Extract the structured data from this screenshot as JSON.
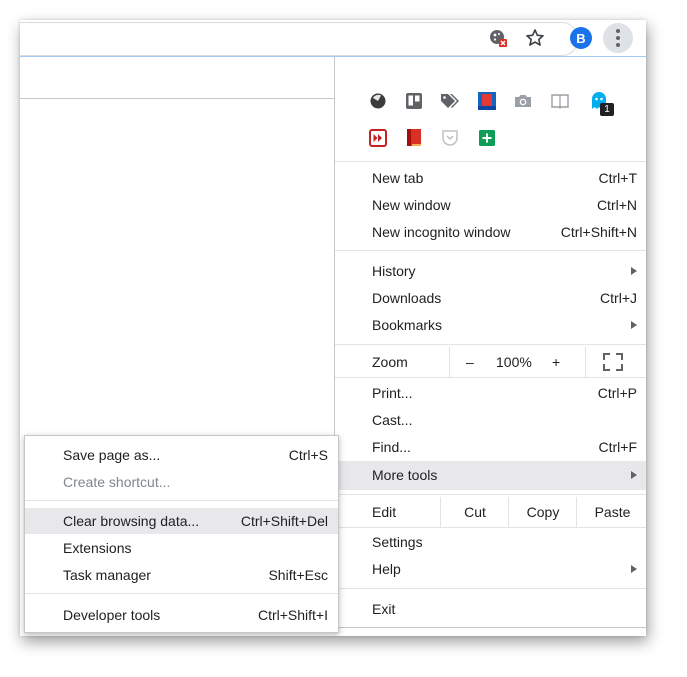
{
  "toolbar": {
    "avatar_letter": "B",
    "icons": [
      "cookie-blocked-icon",
      "bookmark-star-icon",
      "profile-avatar",
      "more-vert-icon"
    ]
  },
  "extensions": {
    "row1": [
      "color-ball-icon",
      "trello-icon",
      "tags-icon",
      "bookmark-manager-icon",
      "camera-icon",
      "reader-icon",
      "ghostery-icon"
    ],
    "row2": [
      "fast-forward-icon",
      "book-icon",
      "pocket-icon",
      "add-icon"
    ],
    "badge": "1"
  },
  "menu": {
    "new_tab": {
      "label": "New tab",
      "shortcut": "Ctrl+T"
    },
    "new_window": {
      "label": "New window",
      "shortcut": "Ctrl+N"
    },
    "new_incognito": {
      "label": "New incognito window",
      "shortcut": "Ctrl+Shift+N"
    },
    "history": {
      "label": "History"
    },
    "downloads": {
      "label": "Downloads",
      "shortcut": "Ctrl+J"
    },
    "bookmarks": {
      "label": "Bookmarks"
    },
    "zoom": {
      "label": "Zoom",
      "minus": "–",
      "level": "100%",
      "plus": "+"
    },
    "print": {
      "label": "Print...",
      "shortcut": "Ctrl+P"
    },
    "cast": {
      "label": "Cast..."
    },
    "find": {
      "label": "Find...",
      "shortcut": "Ctrl+F"
    },
    "more_tools": {
      "label": "More tools"
    },
    "edit": {
      "label": "Edit",
      "cut": "Cut",
      "copy": "Copy",
      "paste": "Paste"
    },
    "settings": {
      "label": "Settings"
    },
    "help": {
      "label": "Help"
    },
    "exit": {
      "label": "Exit"
    }
  },
  "submenu": {
    "save_page": {
      "label": "Save page as...",
      "shortcut": "Ctrl+S"
    },
    "create_shortcut": {
      "label": "Create shortcut..."
    },
    "clear_browsing": {
      "label": "Clear browsing data...",
      "shortcut": "Ctrl+Shift+Del"
    },
    "extensions": {
      "label": "Extensions"
    },
    "task_manager": {
      "label": "Task manager",
      "shortcut": "Shift+Esc"
    },
    "developer_tools": {
      "label": "Developer tools",
      "shortcut": "Ctrl+Shift+I"
    }
  },
  "colors": {
    "accent": "#1a73e8",
    "highlight": "#e8e8ea",
    "separator": "#e3e3e3"
  }
}
